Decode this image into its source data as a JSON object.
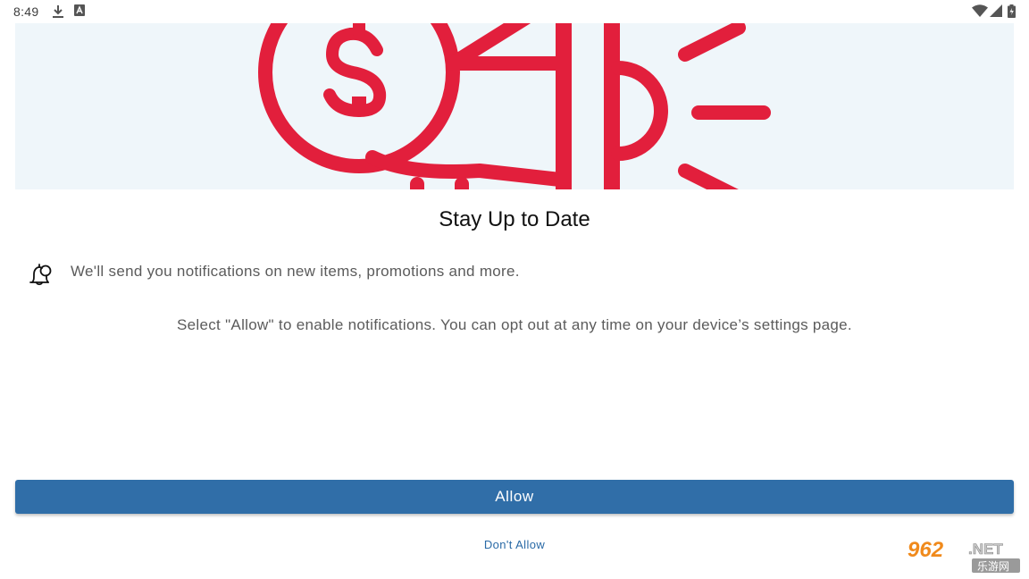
{
  "status_bar": {
    "time": "8:49",
    "icons": [
      "download-icon",
      "app-notification-icon",
      "wifi-icon",
      "cell-signal-icon",
      "battery-icon"
    ]
  },
  "hero": {
    "illustration": "megaphone-dollar-icon",
    "background_color": "#eff6fa",
    "accent_color": "#e21f3c"
  },
  "dialog": {
    "title": "Stay Up to Date",
    "notification_icon": "bell-icon",
    "notification_text": "We'll send you notifications on new items, promotions and more.",
    "opt_out_text": "Select \"Allow\" to enable notifications. You can opt out at any time on your device’s settings page."
  },
  "actions": {
    "allow_label": "Allow",
    "allow_color": "#306ea8",
    "dont_allow_label": "Don't Allow"
  },
  "watermark": {
    "brand": "962",
    "suffix": ".NET",
    "caption": "乐游网"
  }
}
